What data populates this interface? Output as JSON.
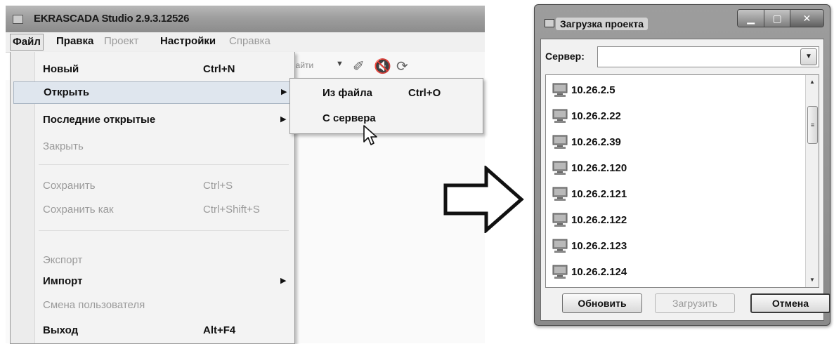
{
  "app": {
    "title": "EKRASCADA Studio 2.9.3.12526",
    "menubar": [
      "Файл",
      "Правка",
      "Проект",
      "Настройки",
      "Справка"
    ],
    "toolbar_text": "Найти"
  },
  "file_menu": {
    "items": [
      {
        "label": "Новый",
        "shortcut": "Ctrl+N"
      },
      {
        "label": "Открыть",
        "shortcut": ""
      },
      {
        "label": "Последние открытые",
        "shortcut": ""
      },
      {
        "label": "Закрыть",
        "shortcut": ""
      },
      {
        "label": "Сохранить",
        "shortcut": "Ctrl+S"
      },
      {
        "label": "Сохранить как",
        "shortcut": "Ctrl+Shift+S"
      },
      {
        "label": "Экспорт",
        "shortcut": ""
      },
      {
        "label": "Импорт",
        "shortcut": ""
      },
      {
        "label": "Смена пользователя",
        "shortcut": ""
      },
      {
        "label": "Выход",
        "shortcut": "Alt+F4"
      }
    ]
  },
  "open_submenu": {
    "items": [
      {
        "label": "Из файла",
        "shortcut": "Ctrl+O"
      },
      {
        "label": "С сервера",
        "shortcut": ""
      }
    ]
  },
  "dialog": {
    "title": "Загрузка проекта",
    "server_label": "Сервер:",
    "server_value": "",
    "servers": [
      "10.26.2.5",
      "10.26.2.22",
      "10.26.2.39",
      "10.26.2.120",
      "10.26.2.121",
      "10.26.2.122",
      "10.26.2.123",
      "10.26.2.124"
    ],
    "buttons": {
      "refresh": "Обновить",
      "load": "Загрузить",
      "cancel": "Отмена"
    }
  },
  "colors": {
    "menu_highlight": "#dfe6ee",
    "disabled_text": "#9a9a9a",
    "arrow_stroke": "#111111"
  }
}
